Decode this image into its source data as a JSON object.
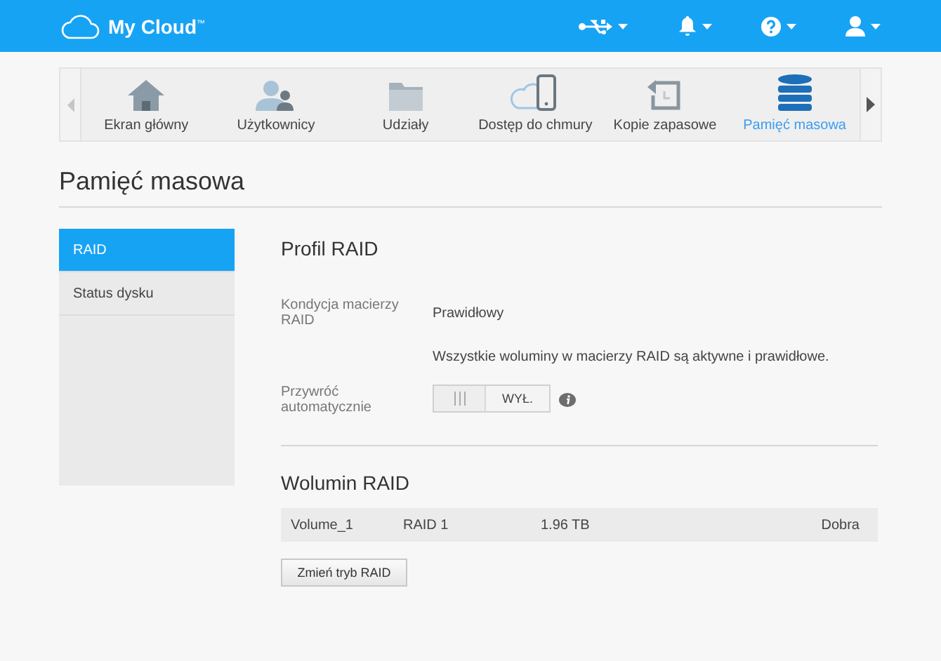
{
  "header": {
    "logo": "My Cloud$^{™}$"
  },
  "nav": {
    "items": [
      {
        "label": "Ekran główny",
        "selected": false
      },
      {
        "label": "Użytkownicy",
        "selected": false
      },
      {
        "label": "Udziały",
        "selected": false
      },
      {
        "label": "Dostęp do chmury",
        "selected": false
      },
      {
        "label": "Kopie zapasowe",
        "selected": false
      },
      {
        "label": "Pamięć masowa",
        "selected": true
      }
    ]
  },
  "page_title": "Pamięć masowa",
  "sidebar": {
    "items": [
      {
        "label": "RAID",
        "selected": true
      },
      {
        "label": "Status dysku",
        "selected": false
      }
    ]
  },
  "profile": {
    "title": "Profil RAID",
    "condition_label": "Kondycja macierzy RAID",
    "condition_value": "Prawidłowy",
    "message": "Wszystkie woluminy w macierzy RAID są aktywne i prawidłowe.",
    "auto_restore": {
      "label": "Przywróć automatycznie",
      "state_text": "WYŁ.",
      "on": false
    }
  },
  "volume": {
    "title": "Wolumin RAID",
    "rows": [
      {
        "cells": [
          "Volume_1",
          "RAID 1",
          "1.96 TB",
          "Dobra"
        ]
      }
    ],
    "button": "Zmień tryb RAID"
  }
}
